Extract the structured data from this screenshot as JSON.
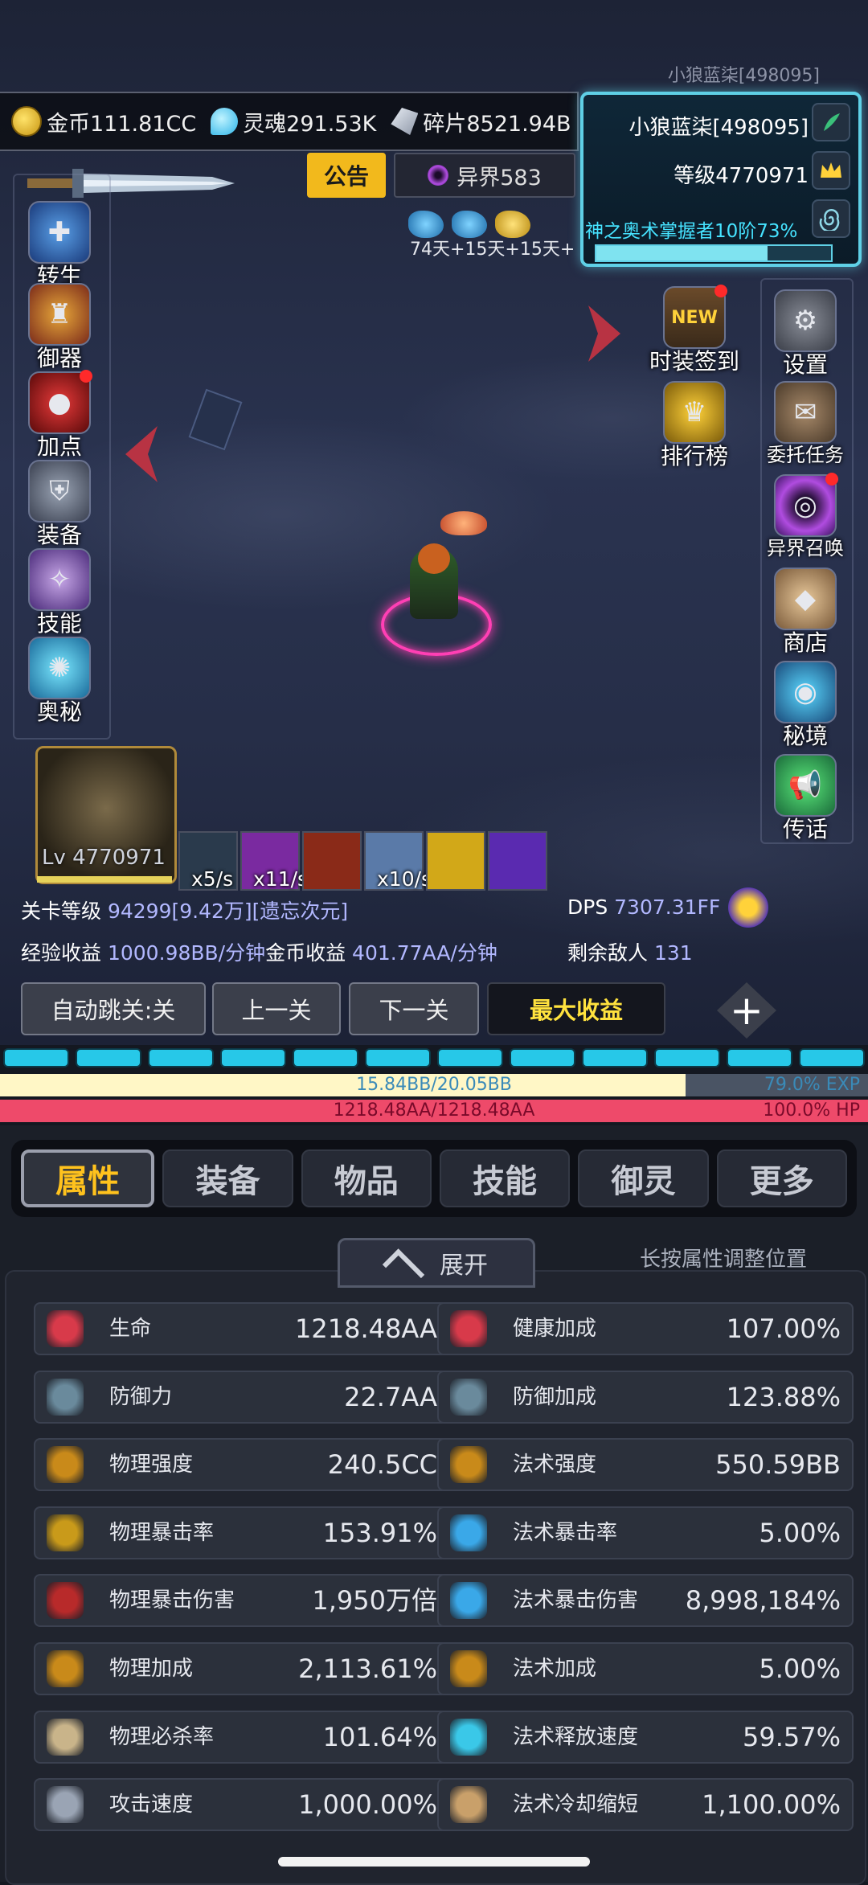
{
  "corner_id": "小狼蓝柒[498095]",
  "currencies": [
    {
      "icon": "coin-icon",
      "label": "金币111.81CC"
    },
    {
      "icon": "soul-icon",
      "label": "灵魂291.53K"
    },
    {
      "icon": "shard-icon",
      "label": "碎片8521.94B"
    }
  ],
  "player": {
    "name": "小狼蓝柒[498095]",
    "level": "等级4770971",
    "title": "神之奥术掌握者10阶73%",
    "title_progress": 0.73
  },
  "notice_label": "公告",
  "otherworld_label": "异界583",
  "buff_text": "74天+15天+15天+",
  "left_menu": [
    {
      "label": "转生",
      "icon": "rebirth-icon",
      "dot": false
    },
    {
      "label": "御器",
      "icon": "artifact-icon",
      "dot": false
    },
    {
      "label": "加点",
      "icon": "points-icon",
      "dot": true
    },
    {
      "label": "装备",
      "icon": "equipment-icon",
      "dot": false
    },
    {
      "label": "技能",
      "icon": "skill-scroll-icon",
      "dot": false
    },
    {
      "label": "奥秘",
      "icon": "mystery-icon",
      "dot": false
    }
  ],
  "right_menu": [
    {
      "label": "时装签到",
      "icon": "new-costume-icon",
      "dot": true
    },
    {
      "label": "设置",
      "icon": "gear-icon",
      "dot": false
    },
    {
      "label": "排行榜",
      "icon": "trophy-icon",
      "dot": false
    },
    {
      "label": "委托任务",
      "icon": "quest-icon",
      "dot": false
    },
    {
      "label": "异界召唤",
      "icon": "portal-icon",
      "dot": true
    },
    {
      "label": "商店",
      "icon": "shop-icon",
      "dot": false
    },
    {
      "label": "秘境",
      "icon": "secret-realm-icon",
      "dot": false
    },
    {
      "label": "传话",
      "icon": "megaphone-icon",
      "dot": false
    }
  ],
  "hero_level": "Lv 4770971",
  "skills": [
    {
      "icon": "skill-1-icon",
      "rate": "x5/s",
      "color": "#2a3a4c"
    },
    {
      "icon": "skill-2-icon",
      "rate": "x11/s",
      "color": "#7a2aa0"
    },
    {
      "icon": "skill-3-icon",
      "rate": "",
      "color": "#8a2a18"
    },
    {
      "icon": "skill-4-icon",
      "rate": "x10/s",
      "color": "#5a7aa8"
    },
    {
      "icon": "skill-5-icon",
      "rate": "",
      "color": "#d2a818"
    },
    {
      "icon": "skill-6-icon",
      "rate": "",
      "color": "#5a2ab0"
    }
  ],
  "stats": {
    "stage_label": "关卡等级",
    "stage_value": "94299[9.42万][遗忘次元]",
    "dps_label": "DPS",
    "dps_value": "7307.31FF",
    "exp_label": "经验收益",
    "exp_value": "1000.98BB/分钟",
    "gold_label": "金币收益",
    "gold_value": "401.77AA/分钟",
    "enemies_label": "剩余敌人",
    "enemies_value": "131"
  },
  "controls": {
    "auto_skip": "自动跳关:关",
    "prev": "上一关",
    "next": "下一关",
    "max": "最大收益",
    "plus": "+"
  },
  "exp_bar": {
    "text": "15.84BB/20.05BB",
    "percent": "79.0% EXP",
    "fraction": 0.79
  },
  "hp_bar": {
    "text": "1218.48AA/1218.48AA",
    "percent": "100.0% HP",
    "fraction": 1.0
  },
  "tabs": [
    "属性",
    "装备",
    "物品",
    "技能",
    "御灵",
    "更多"
  ],
  "expand_label": "展开",
  "hint": "长按属性调整位置",
  "attributes_left": [
    {
      "icon": "heart-icon",
      "name": "生命",
      "value": "1218.48AA",
      "color": "#d83a4a"
    },
    {
      "icon": "shield-icon",
      "name": "防御力",
      "value": "22.7AA",
      "color": "#6a8a9c"
    },
    {
      "icon": "physical-power-icon",
      "name": "物理强度",
      "value": "240.5CC",
      "color": "#c98a1a"
    },
    {
      "icon": "physical-crit-rate-icon",
      "name": "物理暴击率",
      "value": "153.91%",
      "color": "#c99a1a"
    },
    {
      "icon": "physical-crit-damage-icon",
      "name": "物理暴击伤害",
      "value": "1,950万倍",
      "color": "#b82a2a"
    },
    {
      "icon": "physical-bonus-icon",
      "name": "物理加成",
      "value": "2,113.61%",
      "color": "#c98a1a"
    },
    {
      "icon": "skull-icon",
      "name": "物理必杀率",
      "value": "101.64%",
      "color": "#c9b48a"
    },
    {
      "icon": "attack-speed-icon",
      "name": "攻击速度",
      "value": "1,000.00%",
      "color": "#9aa4b4"
    }
  ],
  "attributes_right": [
    {
      "icon": "health-bonus-icon",
      "name": "健康加成",
      "value": "107.00%",
      "color": "#d83a4a"
    },
    {
      "icon": "defense-bonus-icon",
      "name": "防御加成",
      "value": "123.88%",
      "color": "#6a8a9c"
    },
    {
      "icon": "magic-power-icon",
      "name": "法术强度",
      "value": "550.59BB",
      "color": "#c98a1a"
    },
    {
      "icon": "magic-crit-rate-icon",
      "name": "法术暴击率",
      "value": "5.00%",
      "color": "#3aa8e8"
    },
    {
      "icon": "magic-crit-damage-icon",
      "name": "法术暴击伤害",
      "value": "8,998,184%",
      "color": "#3aa8e8"
    },
    {
      "icon": "magic-bonus-icon",
      "name": "法术加成",
      "value": "5.00%",
      "color": "#c98a1a"
    },
    {
      "icon": "cast-speed-icon",
      "name": "法术释放速度",
      "value": "59.57%",
      "color": "#3ac8e8"
    },
    {
      "icon": "cooldown-icon",
      "name": "法术冷却缩短",
      "value": "1,100.00%",
      "color": "#c9a06a"
    }
  ]
}
